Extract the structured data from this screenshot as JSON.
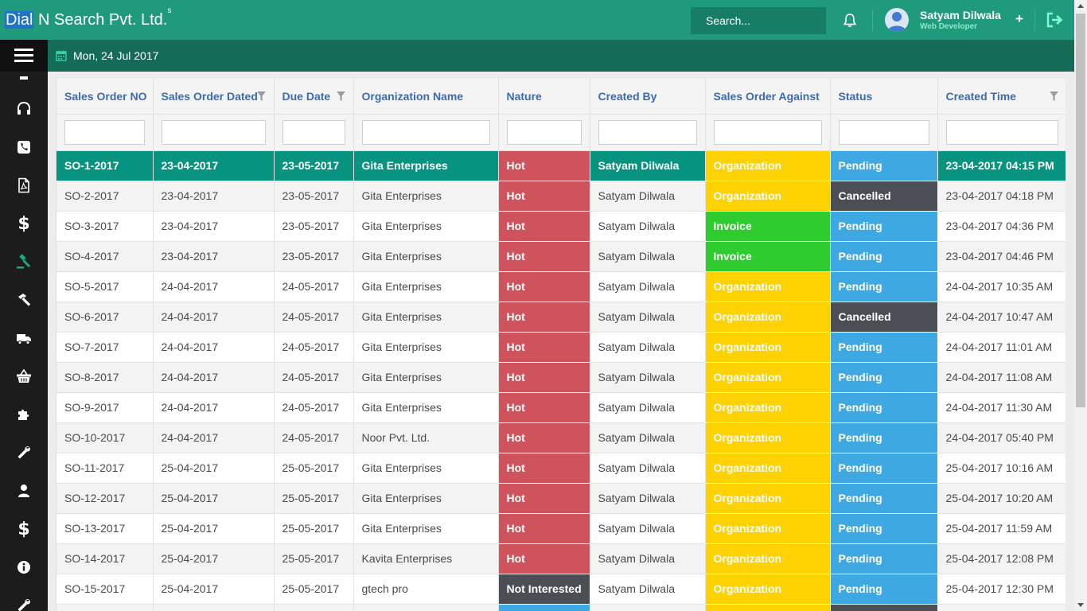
{
  "app": {
    "brand_highlight": "Dial",
    "brand_rest": " N Search Pvt. Ltd.",
    "brand_super": "s"
  },
  "header": {
    "search_placeholder": "Search...",
    "user_name": "Satyam Dilwala",
    "user_role": "Web Developer",
    "plus_label": "+",
    "date": "Mon, 24 Jul 2017"
  },
  "sidebar": {
    "items": [
      {
        "icon": "headset-icon"
      },
      {
        "icon": "phone-icon"
      },
      {
        "icon": "pdf-file-icon"
      },
      {
        "icon": "dollar-icon",
        "glyph": "$"
      },
      {
        "icon": "gavel-icon",
        "active": true
      },
      {
        "icon": "hammer-icon"
      },
      {
        "icon": "truck-icon"
      },
      {
        "icon": "basket-icon"
      },
      {
        "icon": "puzzle-icon"
      },
      {
        "icon": "wrench-icon"
      },
      {
        "icon": "user-icon"
      },
      {
        "icon": "dollar-icon",
        "glyph": "$"
      },
      {
        "icon": "info-icon"
      },
      {
        "icon": "wrench-icon"
      }
    ]
  },
  "table": {
    "columns": [
      {
        "label": "Sales Order NO",
        "filter": false
      },
      {
        "label": "Sales Order Dated",
        "filter": true
      },
      {
        "label": "Due Date",
        "filter": true
      },
      {
        "label": "Organization Name",
        "filter": false
      },
      {
        "label": "Nature",
        "filter": false
      },
      {
        "label": "Created By",
        "filter": false
      },
      {
        "label": "Sales Order Against",
        "filter": false
      },
      {
        "label": "Status",
        "filter": false
      },
      {
        "label": "Created Time",
        "filter": true
      }
    ],
    "rows": [
      [
        "SO-1-2017",
        "23-04-2017",
        "23-05-2017",
        "Gita Enterprises",
        "Hot",
        "Satyam Dilwala",
        "Organization",
        "Pending",
        "23-04-2017 04:15 PM"
      ],
      [
        "SO-2-2017",
        "23-04-2017",
        "23-05-2017",
        "Gita Enterprises",
        "Hot",
        "Satyam Dilwala",
        "Organization",
        "Cancelled",
        "23-04-2017 04:18 PM"
      ],
      [
        "SO-3-2017",
        "23-04-2017",
        "23-05-2017",
        "Gita Enterprises",
        "Hot",
        "Satyam Dilwala",
        "Invoice",
        "Pending",
        "23-04-2017 04:36 PM"
      ],
      [
        "SO-4-2017",
        "23-04-2017",
        "23-05-2017",
        "Gita Enterprises",
        "Hot",
        "Satyam Dilwala",
        "Invoice",
        "Pending",
        "23-04-2017 04:46 PM"
      ],
      [
        "SO-5-2017",
        "24-04-2017",
        "24-05-2017",
        "Gita Enterprises",
        "Hot",
        "Satyam Dilwala",
        "Organization",
        "Pending",
        "24-04-2017 10:35 AM"
      ],
      [
        "SO-6-2017",
        "24-04-2017",
        "24-05-2017",
        "Gita Enterprises",
        "Hot",
        "Satyam Dilwala",
        "Organization",
        "Cancelled",
        "24-04-2017 10:47 AM"
      ],
      [
        "SO-7-2017",
        "24-04-2017",
        "24-05-2017",
        "Gita Enterprises",
        "Hot",
        "Satyam Dilwala",
        "Organization",
        "Pending",
        "24-04-2017 11:01 AM"
      ],
      [
        "SO-8-2017",
        "24-04-2017",
        "24-05-2017",
        "Gita Enterprises",
        "Hot",
        "Satyam Dilwala",
        "Organization",
        "Pending",
        "24-04-2017 11:08 AM"
      ],
      [
        "SO-9-2017",
        "24-04-2017",
        "24-05-2017",
        "Gita Enterprises",
        "Hot",
        "Satyam Dilwala",
        "Organization",
        "Pending",
        "24-04-2017 11:30 AM"
      ],
      [
        "SO-10-2017",
        "24-04-2017",
        "24-05-2017",
        "Noor Pvt. Ltd.",
        "Hot",
        "Satyam Dilwala",
        "Organization",
        "Pending",
        "24-04-2017 05:40 PM"
      ],
      [
        "SO-11-2017",
        "25-04-2017",
        "25-05-2017",
        "Gita Enterprises",
        "Hot",
        "Satyam Dilwala",
        "Organization",
        "Pending",
        "25-04-2017 10:16 AM"
      ],
      [
        "SO-12-2017",
        "25-04-2017",
        "25-05-2017",
        "Gita Enterprises",
        "Hot",
        "Satyam Dilwala",
        "Organization",
        "Pending",
        "25-04-2017 10:20 AM"
      ],
      [
        "SO-13-2017",
        "25-04-2017",
        "25-05-2017",
        "Gita Enterprises",
        "Hot",
        "Satyam Dilwala",
        "Organization",
        "Pending",
        "25-04-2017 11:59 AM"
      ],
      [
        "SO-14-2017",
        "25-04-2017",
        "25-05-2017",
        "Kavita Enterprises",
        "Hot",
        "Satyam Dilwala",
        "Organization",
        "Pending",
        "25-04-2017 12:08 PM"
      ],
      [
        "SO-15-2017",
        "25-04-2017",
        "25-05-2017",
        "gtech pro",
        "Not Interested",
        "Satyam Dilwala",
        "Organization",
        "Pending",
        "25-04-2017 12:30 PM"
      ],
      [
        "",
        "",
        "",
        "",
        "",
        "",
        "",
        "",
        ""
      ]
    ],
    "selected_row": 0
  },
  "colors": {
    "topbar": "#1f9a7d",
    "subbar": "#146b57",
    "sidebar": "#1c1c1c",
    "selected_row": "#069481",
    "hot": "#cf535d",
    "not_interested": "#4b4f55",
    "organization": "#fdd200",
    "invoice": "#2ecc2e",
    "pending": "#3ea8e3",
    "cancelled": "#4b4f55",
    "header_text": "#3b6bb3"
  }
}
